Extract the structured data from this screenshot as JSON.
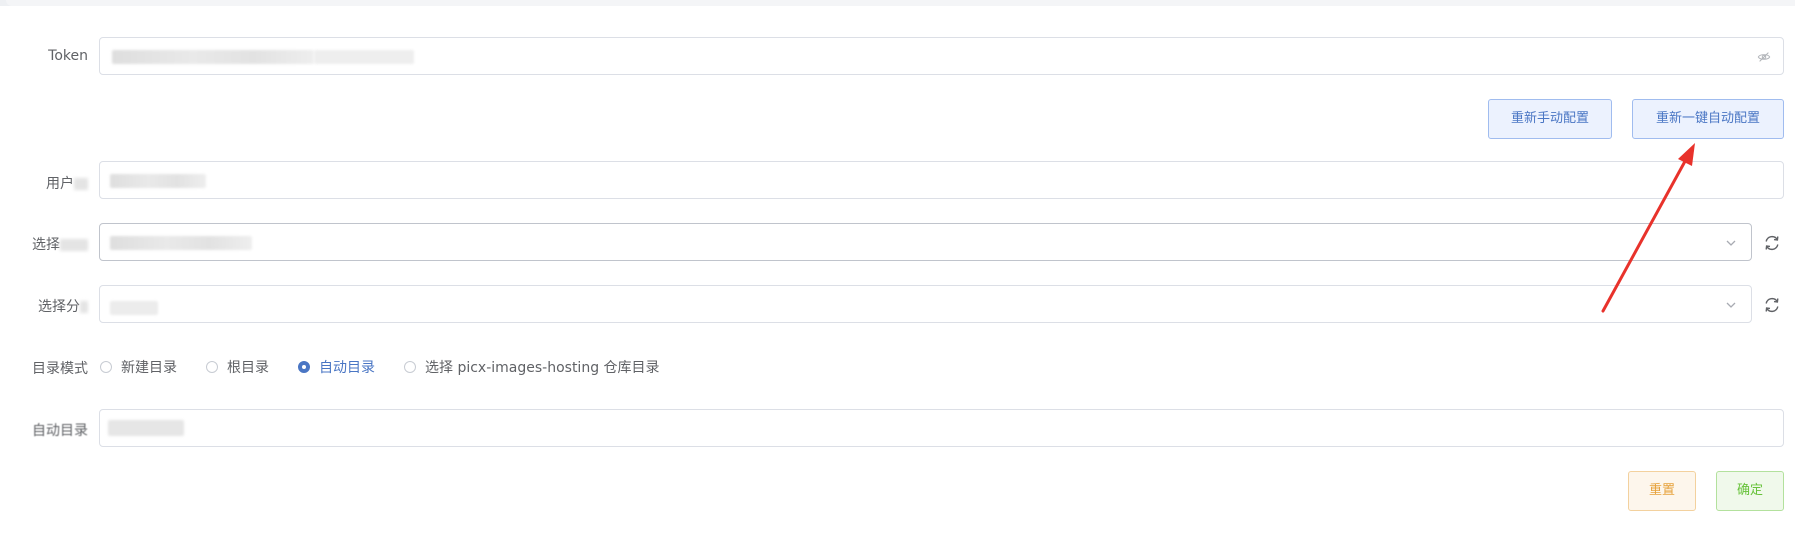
{
  "token": {
    "label": "Token"
  },
  "config_buttons": {
    "manual": "重新手动配置",
    "auto": "重新一键自动配置"
  },
  "user": {
    "label": "用户"
  },
  "repo_select": {
    "label": "选择"
  },
  "branch_select": {
    "label": "选择分"
  },
  "dir_mode": {
    "label": "目录模式",
    "options": [
      {
        "label": "新建目录",
        "checked": false
      },
      {
        "label": "根目录",
        "checked": false
      },
      {
        "label": "自动目录",
        "checked": true
      },
      {
        "label": "选择 picx-images-hosting 仓库目录",
        "checked": false
      }
    ]
  },
  "auto_dir": {
    "label": "自动目录"
  },
  "footer": {
    "reset": "重置",
    "confirm": "确定"
  },
  "icons": {
    "token_toggle": "eye-off-icon",
    "dropdown": "chevron-down-icon",
    "refresh": "refresh-icon"
  },
  "colors": {
    "primary": "#4a76c4",
    "warning": "#e6a23c",
    "success": "#67c23a",
    "annotation_arrow": "#e8322b"
  }
}
